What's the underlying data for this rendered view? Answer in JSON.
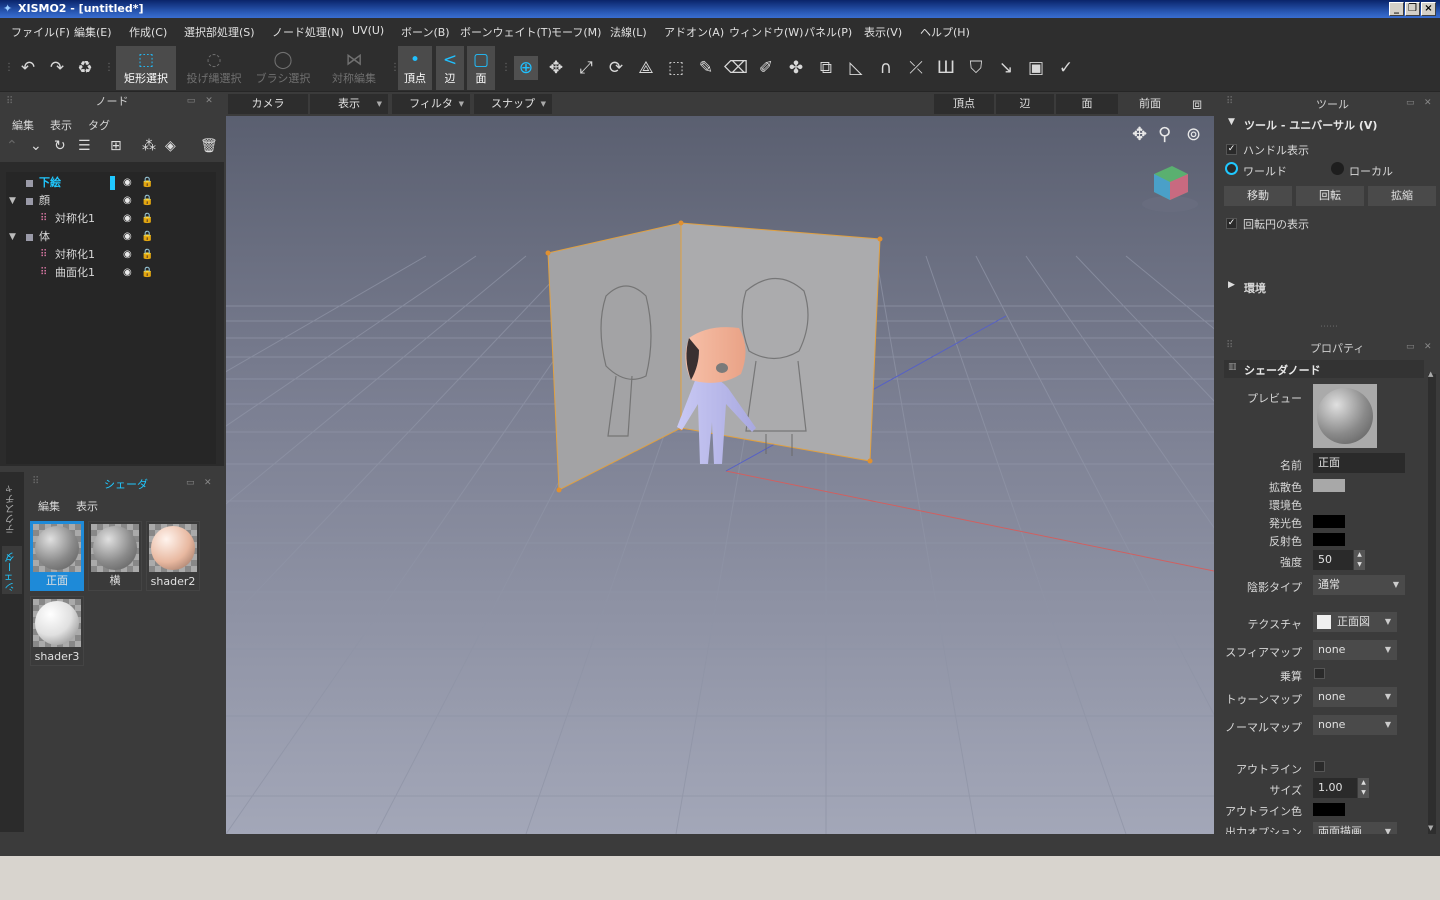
{
  "window": {
    "title": "XISMO2 - [untitled*]",
    "buttons": [
      "_",
      "❐",
      "×"
    ]
  },
  "menu": [
    "ファイル(F)",
    "編集(E)",
    "作成(C)",
    "選択部処理(S)",
    "ノード処理(N)",
    "UV(U)",
    "ボーン(B)",
    "ボーンウェイト(T)",
    "モーフ(M)",
    "法線(L)",
    "アドオン(A)",
    "ウィンドウ(W)",
    "パネル(P)",
    "表示(V)",
    "ヘルプ(H)"
  ],
  "toolbar": {
    "undo": "↶",
    "redo": "↷",
    "recycle": "♻",
    "rect_select": "矩形選択",
    "lasso_select": "投げ縄選択",
    "brush_select": "ブラシ選択",
    "symmetry_edit": "対称編集",
    "vertex": "頂点",
    "edge": "辺",
    "face": "面"
  },
  "node_panel": {
    "title": "ノード",
    "menu": [
      "編集",
      "表示",
      "タグ"
    ],
    "tree": [
      {
        "label": "下絵",
        "level": 0,
        "kind": "square",
        "highlight": true
      },
      {
        "label": "顔",
        "level": 0,
        "kind": "square",
        "expand": "▼"
      },
      {
        "label": "対称化1",
        "level": 1,
        "kind": "dots"
      },
      {
        "label": "体",
        "level": 0,
        "kind": "square",
        "expand": "▼"
      },
      {
        "label": "対称化1",
        "level": 1,
        "kind": "dots"
      },
      {
        "label": "曲面化1",
        "level": 1,
        "kind": "dots"
      }
    ]
  },
  "shader_panel": {
    "title": "シェーダ",
    "menu": [
      "編集",
      "表示"
    ],
    "side_tabs": [
      "テクスチャ",
      "シェーダ"
    ],
    "items": [
      {
        "name": "正面",
        "selected": true,
        "ball": "#9a9a9a"
      },
      {
        "name": "横",
        "selected": false,
        "ball": "#9a9a9a"
      },
      {
        "name": "shader2",
        "selected": false,
        "ball": "#e8b8a0"
      },
      {
        "name": "shader3",
        "selected": false,
        "ball": "#e8e8e8"
      }
    ]
  },
  "viewport_bar": {
    "camera": "カメラ",
    "display": "表示",
    "filter": "フィルタ",
    "snap": "スナップ",
    "vertex": "頂点",
    "edge": "辺",
    "face": "面",
    "front": "前面"
  },
  "tool_panel": {
    "title": "ツール",
    "section": "ツール - ユニバーサル (V)",
    "show_handle": "ハンドル表示",
    "world": "ワールド",
    "local": "ローカル",
    "move": "移動",
    "rotate": "回転",
    "scale": "拡縮",
    "show_rotate_circle": "回転円の表示",
    "environment": "環境"
  },
  "property_panel": {
    "title": "プロパティ",
    "section": "シェーダノード",
    "preview_label": "プレビュー",
    "name_label": "名前",
    "name_value": "正面",
    "diffuse_label": "拡散色",
    "diffuse_color": "#a8a8a8",
    "ambient_label": "環境色",
    "ambient_color": "#3b3b3b",
    "emission_label": "発光色",
    "emission_color": "#000000",
    "specular_label": "反射色",
    "specular_color": "#000000",
    "strength_label": "強度",
    "strength_value": "50",
    "shading_label": "陰影タイプ",
    "shading_value": "通常",
    "texture_label": "テクスチャ",
    "texture_value": "正面図",
    "sphere_label": "スフィアマップ",
    "sphere_value": "none",
    "multiply_label": "乗算",
    "toon_label": "トゥーンマップ",
    "toon_value": "none",
    "normal_label": "ノーマルマップ",
    "normal_value": "none",
    "outline_label": "アウトライン",
    "size_label": "サイズ",
    "size_value": "1.00",
    "outline_color_label": "アウトライン色",
    "outline_color": "#000000",
    "output_label": "出力オプション",
    "output_value": "両面描画"
  }
}
